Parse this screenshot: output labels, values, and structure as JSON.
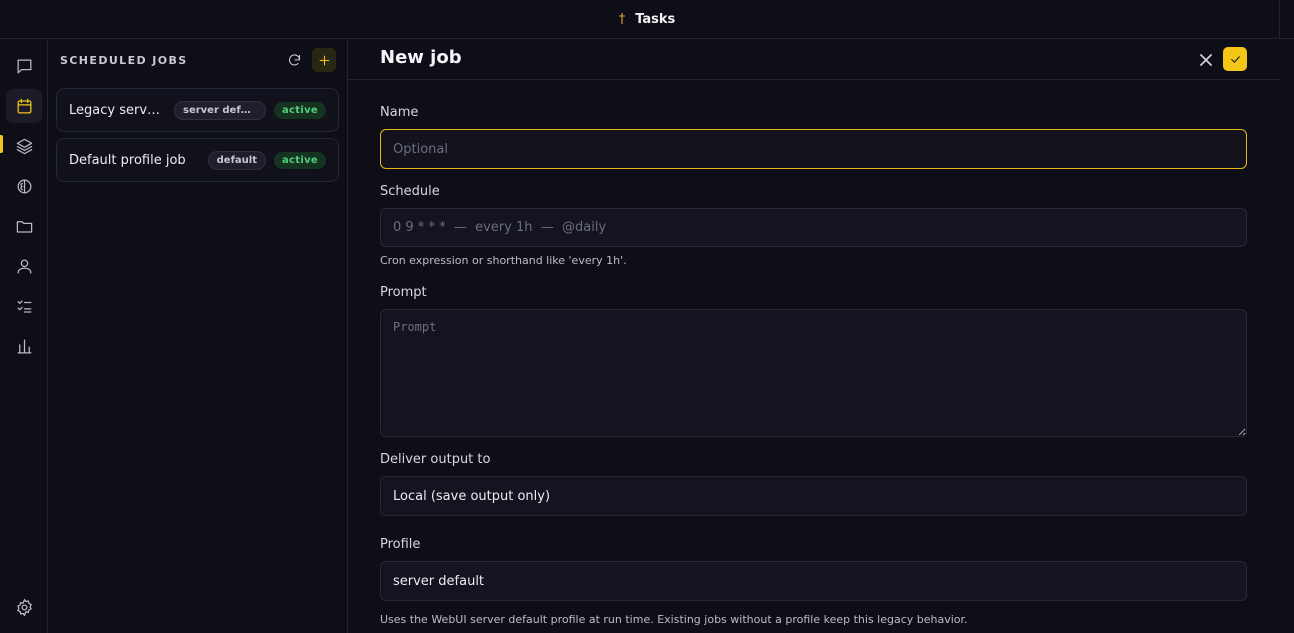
{
  "topbar": {
    "glyph": "†",
    "title": "Tasks"
  },
  "rail": {
    "items": [
      {
        "icon": "chat-icon"
      },
      {
        "icon": "calendar-icon",
        "active": true
      },
      {
        "icon": "layers-icon"
      },
      {
        "icon": "brain-icon"
      },
      {
        "icon": "folder-icon"
      },
      {
        "icon": "user-icon"
      },
      {
        "icon": "checklist-icon"
      },
      {
        "icon": "bar-chart-icon"
      },
      {
        "icon": "settings-icon"
      }
    ],
    "accent": "#f5c518"
  },
  "jobs": {
    "title": "SCHEDULED JOBS",
    "items": [
      {
        "name": "Legacy server default job",
        "profile": "server default",
        "status": "active"
      },
      {
        "name": "Default profile job",
        "profile": "default",
        "status": "active"
      }
    ]
  },
  "editor": {
    "title": "New job",
    "name_label": "Name",
    "name_placeholder": "Optional",
    "schedule_label": "Schedule",
    "schedule_placeholder": "0 9 * * *  —  every 1h  —  @daily",
    "schedule_hint": "Cron expression or shorthand like 'every 1h'.",
    "prompt_label": "Prompt",
    "prompt_placeholder": "Prompt",
    "deliver_label": "Deliver output to",
    "deliver_value": "Local (save output only)",
    "profile_label": "Profile",
    "profile_value": "server default",
    "profile_hint": "Uses the WebUI server default profile at run time. Existing jobs without a profile keep this legacy behavior."
  }
}
